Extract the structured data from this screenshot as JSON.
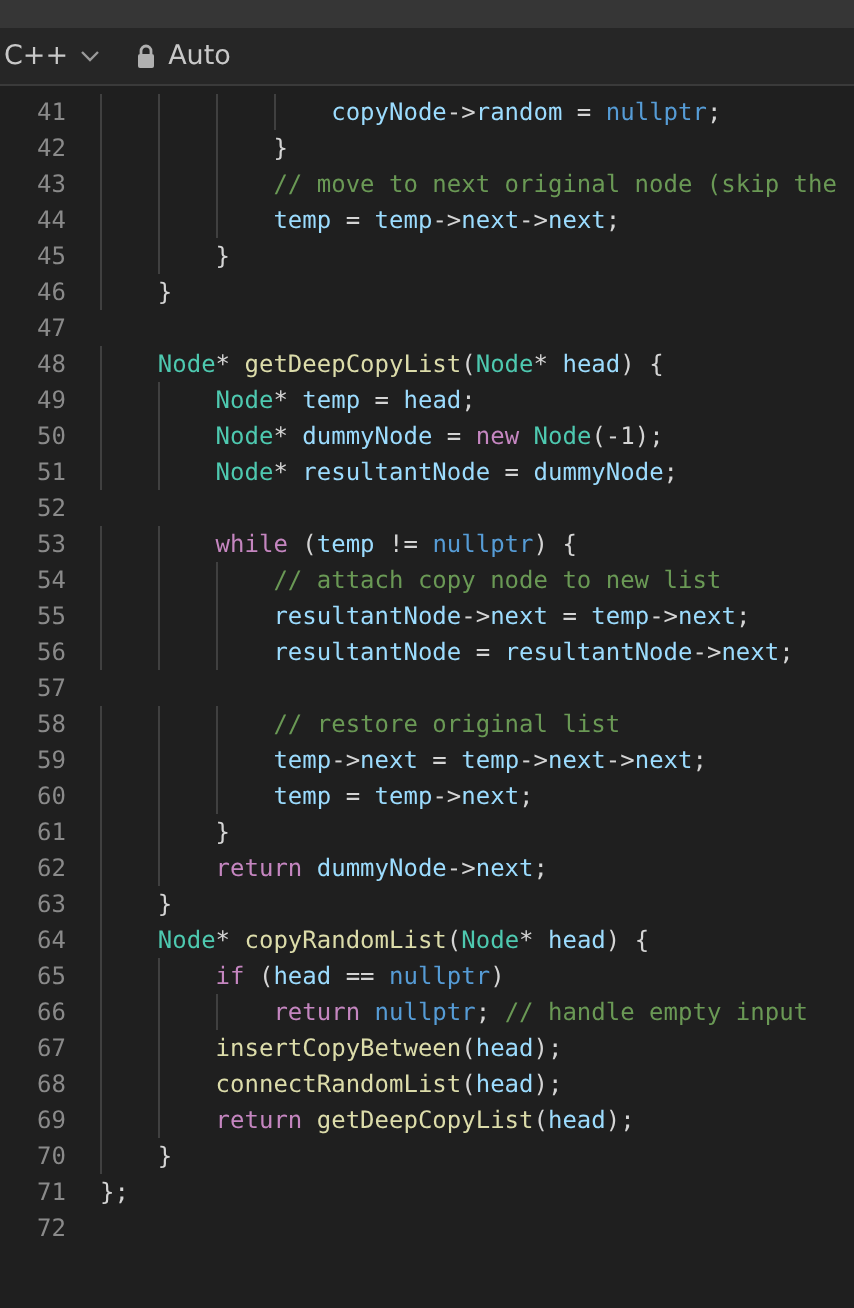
{
  "toolbar": {
    "language": "C++",
    "mode": "Auto"
  },
  "lines": [
    {
      "number": "41",
      "tokens": [
        {
          "text": "                copyNode",
          "kind": "v"
        },
        {
          "text": "->",
          "kind": "p"
        },
        {
          "text": "random",
          "kind": "v"
        },
        {
          "text": " = ",
          "kind": "p"
        },
        {
          "text": "nullptr",
          "kind": "b"
        },
        {
          "text": ";",
          "kind": "p"
        }
      ]
    },
    {
      "number": "42",
      "tokens": [
        {
          "text": "            }",
          "kind": "p"
        }
      ]
    },
    {
      "number": "43",
      "tokens": [
        {
          "text": "            // move to next original node (skip the",
          "kind": "c"
        }
      ]
    },
    {
      "number": "44",
      "tokens": [
        {
          "text": "            temp",
          "kind": "v"
        },
        {
          "text": " = ",
          "kind": "p"
        },
        {
          "text": "temp",
          "kind": "v"
        },
        {
          "text": "->",
          "kind": "p"
        },
        {
          "text": "next",
          "kind": "v"
        },
        {
          "text": "->",
          "kind": "p"
        },
        {
          "text": "next",
          "kind": "v"
        },
        {
          "text": ";",
          "kind": "p"
        }
      ]
    },
    {
      "number": "45",
      "tokens": [
        {
          "text": "        }",
          "kind": "p"
        }
      ]
    },
    {
      "number": "46",
      "tokens": [
        {
          "text": "    }",
          "kind": "p"
        }
      ]
    },
    {
      "number": "47"
    },
    {
      "number": "48",
      "tokens": [
        {
          "text": "    Node",
          "kind": "t"
        },
        {
          "text": "* ",
          "kind": "p"
        },
        {
          "text": "getDeepCopyList",
          "kind": "f"
        },
        {
          "text": "(",
          "kind": "p"
        },
        {
          "text": "Node",
          "kind": "t"
        },
        {
          "text": "* ",
          "kind": "p"
        },
        {
          "text": "head",
          "kind": "v"
        },
        {
          "text": ") {",
          "kind": "p"
        }
      ]
    },
    {
      "number": "49",
      "tokens": [
        {
          "text": "        Node",
          "kind": "t"
        },
        {
          "text": "* ",
          "kind": "p"
        },
        {
          "text": "temp",
          "kind": "v"
        },
        {
          "text": " = ",
          "kind": "p"
        },
        {
          "text": "head",
          "kind": "v"
        },
        {
          "text": ";",
          "kind": "p"
        }
      ]
    },
    {
      "number": "50",
      "tokens": [
        {
          "text": "        Node",
          "kind": "t"
        },
        {
          "text": "* ",
          "kind": "p"
        },
        {
          "text": "dummyNode",
          "kind": "v"
        },
        {
          "text": " = ",
          "kind": "p"
        },
        {
          "text": "new ",
          "kind": "k"
        },
        {
          "text": "Node",
          "kind": "t"
        },
        {
          "text": "(-1);",
          "kind": "p"
        }
      ]
    },
    {
      "number": "51",
      "tokens": [
        {
          "text": "        Node",
          "kind": "t"
        },
        {
          "text": "* ",
          "kind": "p"
        },
        {
          "text": "resultantNode",
          "kind": "v"
        },
        {
          "text": " = ",
          "kind": "p"
        },
        {
          "text": "dummyNode",
          "kind": "v"
        },
        {
          "text": ";",
          "kind": "p"
        }
      ]
    },
    {
      "number": "52"
    },
    {
      "number": "53",
      "tokens": [
        {
          "text": "        while",
          "kind": "k"
        },
        {
          "text": " (",
          "kind": "p"
        },
        {
          "text": "temp",
          "kind": "v"
        },
        {
          "text": " != ",
          "kind": "p"
        },
        {
          "text": "nullptr",
          "kind": "b"
        },
        {
          "text": ") {",
          "kind": "p"
        }
      ]
    },
    {
      "number": "54",
      "tokens": [
        {
          "text": "            // attach copy node to new list",
          "kind": "c"
        }
      ]
    },
    {
      "number": "55",
      "tokens": [
        {
          "text": "            resultantNode",
          "kind": "v"
        },
        {
          "text": "->",
          "kind": "p"
        },
        {
          "text": "next",
          "kind": "v"
        },
        {
          "text": " = ",
          "kind": "p"
        },
        {
          "text": "temp",
          "kind": "v"
        },
        {
          "text": "->",
          "kind": "p"
        },
        {
          "text": "next",
          "kind": "v"
        },
        {
          "text": ";",
          "kind": "p"
        }
      ]
    },
    {
      "number": "56",
      "tokens": [
        {
          "text": "            resultantNode",
          "kind": "v"
        },
        {
          "text": " = ",
          "kind": "p"
        },
        {
          "text": "resultantNode",
          "kind": "v"
        },
        {
          "text": "->",
          "kind": "p"
        },
        {
          "text": "next",
          "kind": "v"
        },
        {
          "text": ";",
          "kind": "p"
        }
      ]
    },
    {
      "number": "57"
    },
    {
      "number": "58",
      "tokens": [
        {
          "text": "            // restore original list",
          "kind": "c"
        }
      ]
    },
    {
      "number": "59",
      "tokens": [
        {
          "text": "            temp",
          "kind": "v"
        },
        {
          "text": "->",
          "kind": "p"
        },
        {
          "text": "next",
          "kind": "v"
        },
        {
          "text": " = ",
          "kind": "p"
        },
        {
          "text": "temp",
          "kind": "v"
        },
        {
          "text": "->",
          "kind": "p"
        },
        {
          "text": "next",
          "kind": "v"
        },
        {
          "text": "->",
          "kind": "p"
        },
        {
          "text": "next",
          "kind": "v"
        },
        {
          "text": ";",
          "kind": "p"
        }
      ]
    },
    {
      "number": "60",
      "tokens": [
        {
          "text": "            temp",
          "kind": "v"
        },
        {
          "text": " = ",
          "kind": "p"
        },
        {
          "text": "temp",
          "kind": "v"
        },
        {
          "text": "->",
          "kind": "p"
        },
        {
          "text": "next",
          "kind": "v"
        },
        {
          "text": ";",
          "kind": "p"
        }
      ]
    },
    {
      "number": "61",
      "tokens": [
        {
          "text": "        }",
          "kind": "p"
        }
      ]
    },
    {
      "number": "62",
      "tokens": [
        {
          "text": "        return ",
          "kind": "k"
        },
        {
          "text": "dummyNode",
          "kind": "v"
        },
        {
          "text": "->",
          "kind": "p"
        },
        {
          "text": "next",
          "kind": "v"
        },
        {
          "text": ";",
          "kind": "p"
        }
      ]
    },
    {
      "number": "63",
      "tokens": [
        {
          "text": "    }",
          "kind": "p"
        }
      ]
    },
    {
      "number": "64",
      "tokens": [
        {
          "text": "    Node",
          "kind": "t"
        },
        {
          "text": "* ",
          "kind": "p"
        },
        {
          "text": "copyRandomList",
          "kind": "f"
        },
        {
          "text": "(",
          "kind": "p"
        },
        {
          "text": "Node",
          "kind": "t"
        },
        {
          "text": "* ",
          "kind": "p"
        },
        {
          "text": "head",
          "kind": "v"
        },
        {
          "text": ") {",
          "kind": "p"
        }
      ]
    },
    {
      "number": "65",
      "tokens": [
        {
          "text": "        if",
          "kind": "k"
        },
        {
          "text": " (",
          "kind": "p"
        },
        {
          "text": "head",
          "kind": "v"
        },
        {
          "text": " == ",
          "kind": "p"
        },
        {
          "text": "nullptr",
          "kind": "b"
        },
        {
          "text": ")",
          "kind": "p"
        }
      ]
    },
    {
      "number": "66",
      "tokens": [
        {
          "text": "            return ",
          "kind": "k"
        },
        {
          "text": "nullptr",
          "kind": "b"
        },
        {
          "text": "; ",
          "kind": "p"
        },
        {
          "text": "// handle empty input",
          "kind": "c"
        }
      ]
    },
    {
      "number": "67",
      "tokens": [
        {
          "text": "        insertCopyBetween",
          "kind": "f"
        },
        {
          "text": "(",
          "kind": "p"
        },
        {
          "text": "head",
          "kind": "v"
        },
        {
          "text": ");",
          "kind": "p"
        }
      ]
    },
    {
      "number": "68",
      "tokens": [
        {
          "text": "        connectRandomList",
          "kind": "f"
        },
        {
          "text": "(",
          "kind": "p"
        },
        {
          "text": "head",
          "kind": "v"
        },
        {
          "text": ");",
          "kind": "p"
        }
      ]
    },
    {
      "number": "69",
      "tokens": [
        {
          "text": "        return ",
          "kind": "k"
        },
        {
          "text": "getDeepCopyList",
          "kind": "f"
        },
        {
          "text": "(",
          "kind": "p"
        },
        {
          "text": "head",
          "kind": "v"
        },
        {
          "text": ");",
          "kind": "p"
        }
      ]
    },
    {
      "number": "70",
      "tokens": [
        {
          "text": "    }",
          "kind": "p"
        }
      ]
    },
    {
      "number": "71",
      "tokens": [
        {
          "text": "};",
          "kind": "p"
        }
      ]
    },
    {
      "number": "72"
    }
  ]
}
